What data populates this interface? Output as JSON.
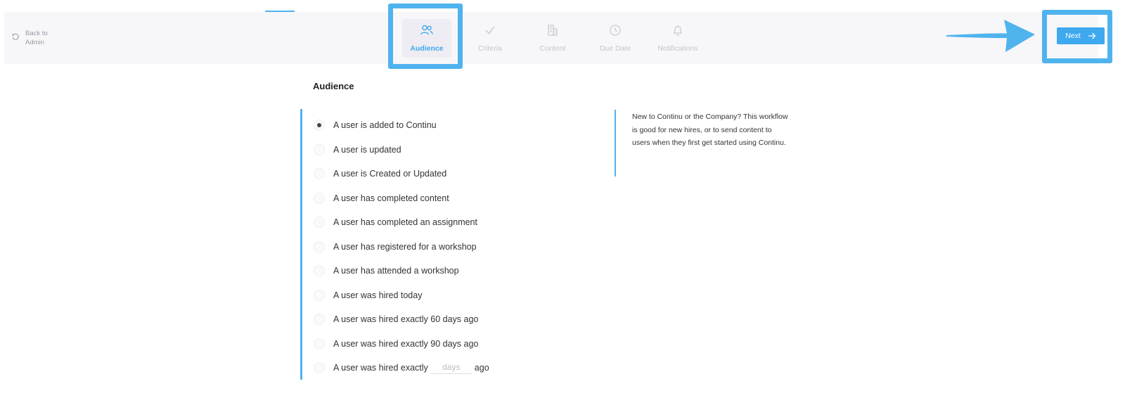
{
  "header": {
    "back_label": "Back to Admin",
    "steps": [
      {
        "label": "Audience",
        "icon": "users-icon",
        "active": true
      },
      {
        "label": "Criteria",
        "icon": "check-icon",
        "active": false
      },
      {
        "label": "Content",
        "icon": "building-icon",
        "active": false
      },
      {
        "label": "Due Date",
        "icon": "clock-icon",
        "active": false
      },
      {
        "label": "Notifications",
        "icon": "bell-icon",
        "active": false
      }
    ],
    "next_label": "Next"
  },
  "main": {
    "title": "Audience",
    "options": [
      "A user is added to Continu",
      "A user is updated",
      "A user is Created or Updated",
      "A user has completed content",
      "A user has completed an assignment",
      "A user has registered for a workshop",
      "A user has attended a workshop",
      "A user was hired today",
      "A user was hired exactly 60 days ago",
      "A user was hired exactly 90 days ago"
    ],
    "selected_index": 0,
    "custom_option": {
      "prefix": "A user was hired exactly",
      "placeholder": "days",
      "value": "",
      "suffix": "ago"
    },
    "description": "New to Continu or the Company? This workflow is good for new hires, or to send content to users when they first get started using Continu."
  },
  "colors": {
    "accent": "#3fa9ef",
    "highlight": "#4fb3ee",
    "header_bg": "#f7f6f9"
  }
}
